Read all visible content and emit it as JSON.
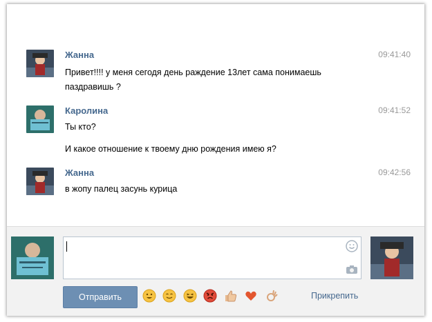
{
  "messages": [
    {
      "author": "Жанна",
      "time": "09:41:40",
      "lines": [
        "Привет!!!! у меня сегодя день раждение 13лет сама понимаешь",
        "паздравишь ?"
      ]
    },
    {
      "author": "Каролина",
      "time": "09:41:52",
      "lines": [
        "Ты кто?",
        "И какое отношение к твоему дню рождения имею я?"
      ]
    },
    {
      "author": "Жанна",
      "time": "09:42:56",
      "lines": [
        "в жопу палец засунь курица"
      ]
    }
  ],
  "composer": {
    "send_label": "Отправить",
    "attach_label": "Прикрепить",
    "input_value": "",
    "emojis": [
      "smile",
      "blush",
      "laugh",
      "angry",
      "thumbs-up",
      "heart",
      "ok-hand"
    ]
  },
  "colors": {
    "link": "#45688e",
    "button": "#6d8fb3",
    "time": "#999999"
  }
}
